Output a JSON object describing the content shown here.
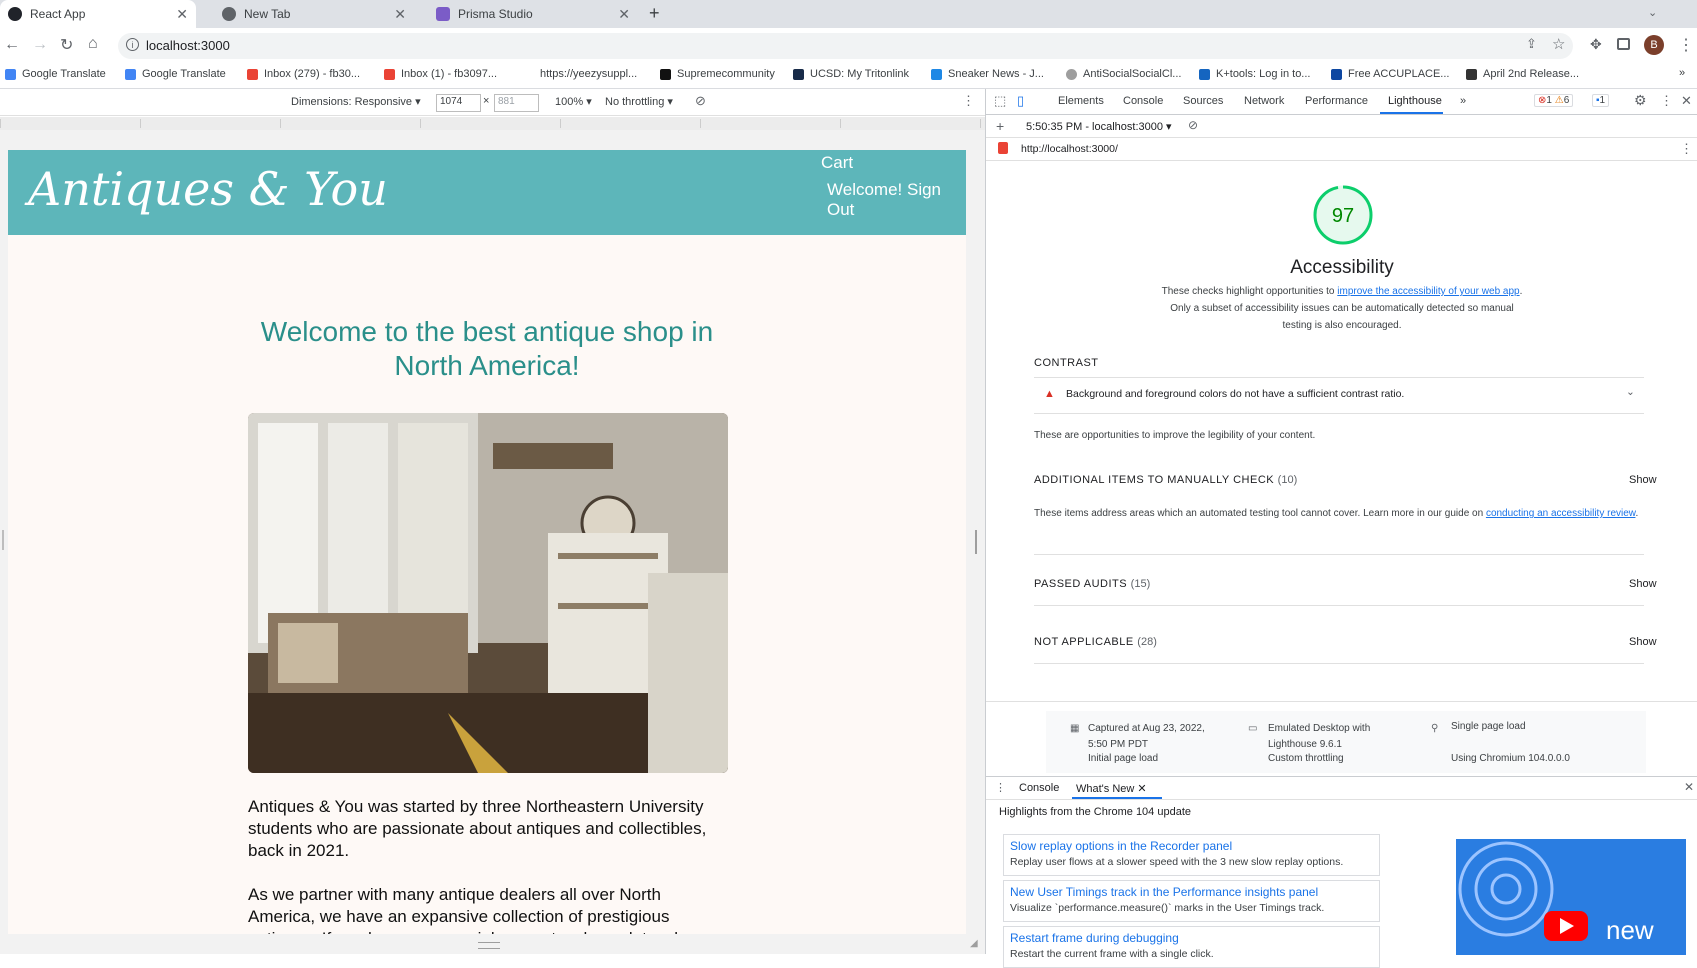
{
  "tabs": [
    {
      "title": "React App",
      "icon": "react-icon",
      "active": true
    },
    {
      "title": "New Tab",
      "icon": "chrome-icon",
      "active": false
    },
    {
      "title": "Prisma Studio",
      "icon": "prisma-icon",
      "active": false
    }
  ],
  "omnibox": {
    "url": "localhost:3000"
  },
  "bookmarks": [
    {
      "label": "Google Translate",
      "icon": "google-translate-icon"
    },
    {
      "label": "Google Translate",
      "icon": "google-translate-icon"
    },
    {
      "label": "Inbox (279) - fb30...",
      "icon": "gmail-icon"
    },
    {
      "label": "Inbox (1) - fb3097...",
      "icon": "gmail-icon"
    },
    {
      "label": "https://yeezysuppl...",
      "icon": ""
    },
    {
      "label": "Supremecommunity",
      "icon": "sc-icon"
    },
    {
      "label": "UCSD: My Tritonlink",
      "icon": "ucsd-icon"
    },
    {
      "label": "Sneaker News - J...",
      "icon": "sn-icon"
    },
    {
      "label": "AntiSocialSocialCl...",
      "icon": "bookmark-icon"
    },
    {
      "label": "K+tools: Log in to...",
      "icon": "k-icon"
    },
    {
      "label": "Free ACCUPLACE...",
      "icon": "accuplacer-icon"
    },
    {
      "label": "April 2nd Release...",
      "icon": "bookmark-icon"
    }
  ],
  "device_toolbar": {
    "dimensions_label": "Dimensions: Responsive",
    "width": "1074",
    "times": "×",
    "height": "881",
    "zoom": "100%",
    "throttle": "No throttling"
  },
  "site": {
    "logo": "Antiques & You",
    "nav_cart": "Cart",
    "nav_welcome_line1": "Welcome! Sign",
    "nav_welcome_line2": "Out",
    "heading_line1": "Welcome to the best antique shop in",
    "heading_line2": "North America!",
    "para1": "Antiques & You was started by three Northeastern University students who are passionate about antiques and collectibles, back in 2021.",
    "para2": "As we partner with many antique dealers all over North America, we have an expansive collection of prestigious antiques. If you have any special requests, please let us know."
  },
  "devtools": {
    "tabs": [
      "Elements",
      "Console",
      "Sources",
      "Network",
      "Performance",
      "Lighthouse"
    ],
    "active_tab": "Lighthouse",
    "more": "»",
    "errors": "1",
    "warnings": "6",
    "messages": "1",
    "report_select": "5:50:35 PM - localhost:3000",
    "report_url": "http://localhost:3000/",
    "score": "97",
    "category": "Accessibility",
    "desc_pre": "These checks highlight opportunities to ",
    "desc_link": "improve the accessibility of your web app",
    "desc_post": ". Only a subset of accessibility issues can be automatically detected so manual testing is also encouraged.",
    "contrast_heading": "CONTRAST",
    "contrast_item": "Background and foreground colors do not have a sufficient contrast ratio.",
    "contrast_note": "These are opportunities to improve the legibility of your content.",
    "manual_heading": "ADDITIONAL ITEMS TO MANUALLY CHECK",
    "manual_count": "(10)",
    "manual_desc_pre": "These items address areas which an automated testing tool cannot cover. Learn more in our guide on ",
    "manual_desc_link": "conducting an accessibility review",
    "manual_desc_post": ".",
    "passed_heading": "PASSED AUDITS",
    "passed_count": "(15)",
    "na_heading": "NOT APPLICABLE",
    "na_count": "(28)",
    "show": "Show",
    "captured": "Captured at Aug 23, 2022, 5:50 PM PDT",
    "emulated": "Emulated Desktop with Lighthouse 9.6.1",
    "single": "Single page load",
    "initial": "Initial page load",
    "custom": "Custom throttling",
    "chromium": "Using Chromium 104.0.0.0"
  },
  "drawer": {
    "tab_console": "Console",
    "tab_whats_new": "What's New",
    "highlights": "Highlights from the Chrome 104 update",
    "cards": [
      {
        "title": "Slow replay options in the Recorder panel",
        "desc": "Replay user flows at a slower speed with the 3 new slow replay options."
      },
      {
        "title": "New User Timings track in the Performance insights panel",
        "desc": "Visualize `performance.measure()` marks in the User Timings track."
      },
      {
        "title": "Restart frame during debugging",
        "desc": "Restart the current frame with a single click."
      }
    ],
    "video_label": "new"
  },
  "colors": {
    "site_header": "#5db6ba",
    "heading_teal": "#2a8f8a",
    "score_green": "#0cce6b",
    "link_blue": "#1a73e8"
  }
}
